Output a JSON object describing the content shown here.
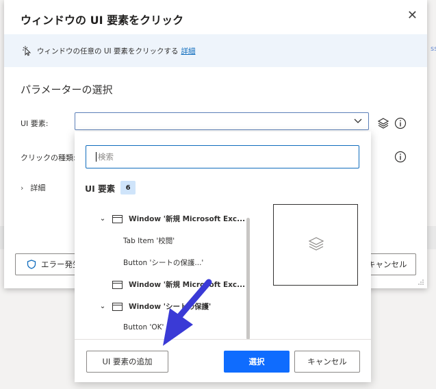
{
  "background": {
    "side_text": "sse"
  },
  "dialog": {
    "title": "ウィンドウの UI 要素をクリック",
    "close_icon": "close-icon",
    "info": {
      "text": "ウィンドウの任意の UI 要素をクリックする",
      "link": "詳細",
      "icon": "click-cursor-icon"
    },
    "section_title": "パラメーターの選択",
    "fields": {
      "ui_element_label": "UI 要素:",
      "ui_element_value": "",
      "click_type_label": "クリックの種類:"
    },
    "details_label": "詳細",
    "footer": {
      "error_button": "エラー発生",
      "cancel_button": "キャンセル"
    }
  },
  "dropdown": {
    "search_placeholder": "検索",
    "heading": "UI 要素",
    "count": "6",
    "tree": [
      {
        "label": "Window '新規 Microsoft Exc...",
        "type": "window",
        "expanded": true
      },
      {
        "label": "Tab Item '校閲'",
        "type": "item"
      },
      {
        "label": "Button 'シートの保護...'",
        "type": "item"
      },
      {
        "label": "Window '新規 Microsoft Exc...",
        "type": "window"
      },
      {
        "label": "Window 'シートの保護'",
        "type": "window",
        "expanded": true
      },
      {
        "label": "Button 'OK'",
        "type": "item"
      }
    ],
    "add_button": "UI 要素の追加",
    "select_button": "選択",
    "cancel_button": "キャンセル"
  },
  "colors": {
    "accent": "#0f6cbd",
    "primary_button": "#0f6cfe",
    "annotation_arrow": "#3a3ad6"
  }
}
